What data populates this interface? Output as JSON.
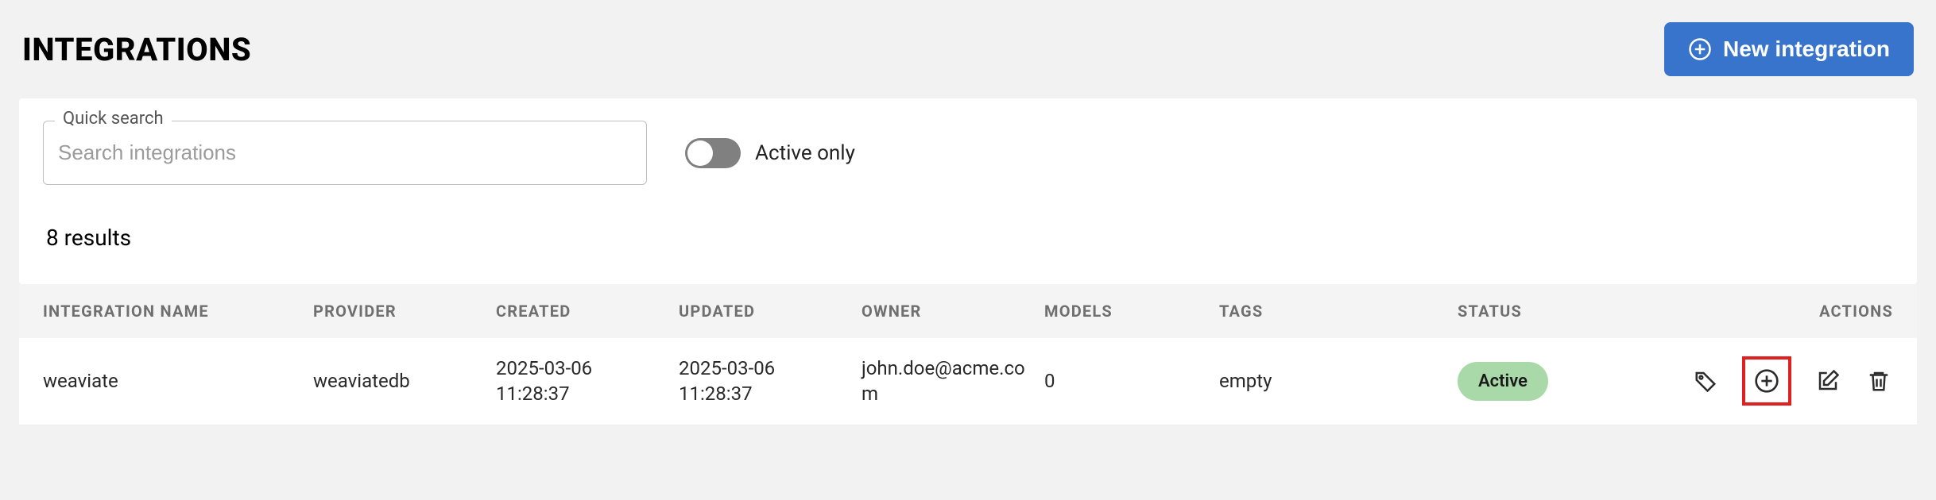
{
  "header": {
    "title": "INTEGRATIONS",
    "new_button": "New integration"
  },
  "search": {
    "legend": "Quick search",
    "placeholder": "Search integrations",
    "value": ""
  },
  "toggle": {
    "label": "Active only",
    "on": false
  },
  "results_text": "8 results",
  "columns": {
    "name": "INTEGRATION NAME",
    "provider": "PROVIDER",
    "created": "CREATED",
    "updated": "UPDATED",
    "owner": "OWNER",
    "models": "MODELS",
    "tags": "TAGS",
    "status": "STATUS",
    "actions": "ACTIONS"
  },
  "rows": [
    {
      "name": "weaviate",
      "provider": "weaviatedb",
      "created": "2025-03-06 11:28:37",
      "updated": "2025-03-06 11:28:37",
      "owner": "john.doe@acme.com",
      "models": "0",
      "tags": "empty",
      "status": "Active"
    }
  ]
}
